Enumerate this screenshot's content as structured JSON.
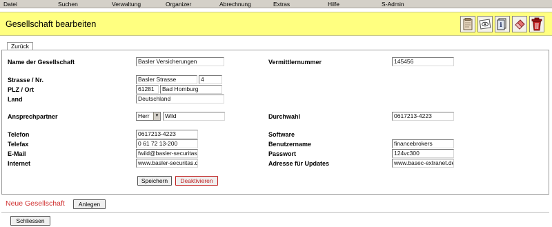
{
  "menu": [
    "Datei",
    "Suchen",
    "Verwaltung",
    "Organizer",
    "Abrechnung",
    "Extras",
    "Hilfe",
    "S-Admin"
  ],
  "title": "Gesellschaft bearbeiten",
  "toolbar": {
    "icons": [
      "notepad-icon",
      "view-icon",
      "info-document-icon",
      "eraser-icon",
      "trash-icon"
    ]
  },
  "tab": {
    "back_label": "Zurück"
  },
  "form": {
    "name_label": "Name der Gesellschaft",
    "name_value": "Basler Versicherungen",
    "vermittler_label": "Vermittlernummer",
    "vermittler_value": "145456",
    "strasse_label": "Strasse / Nr.",
    "strasse_value": "Basler Strasse",
    "nr_value": "4",
    "plz_label": "PLZ / Ort",
    "plz_value": "61281",
    "ort_value": "Bad Homburg",
    "land_label": "Land",
    "land_value": "Deutschland",
    "ansprech_label": "Ansprechpartner",
    "anrede_value": "Herr",
    "ansprech_value": "Wild",
    "durchwahl_label": "Durchwahl",
    "durchwahl_value": "0617213-4223",
    "telefon_label": "Telefon",
    "telefon_value": "0617213-4223",
    "software_label": "Software",
    "telefax_label": "Telefax",
    "telefax_value": "0 61 72 13-200",
    "benutzer_label": "Benutzername",
    "benutzer_value": "financebrokers",
    "email_label": "E-Mail",
    "email_value": "fwild@basler-securitas.",
    "passwort_label": "Passwort",
    "passwort_value": "124vc300",
    "internet_label": "Internet",
    "internet_value": "www.basler-securitas.de",
    "updates_label": "Adresse für Updates",
    "updates_value": "www.basec-extranet.de",
    "save_label": "Speichern",
    "deactivate_label": "Deaktivieren"
  },
  "new_company": {
    "label": "Neue Gesellschaft",
    "button": "Anlegen"
  },
  "close_label": "Schliessen",
  "colors": {
    "title_bar": "#ffff80",
    "menu_bar": "#d4d0c8",
    "accent_red": "#d03030"
  }
}
